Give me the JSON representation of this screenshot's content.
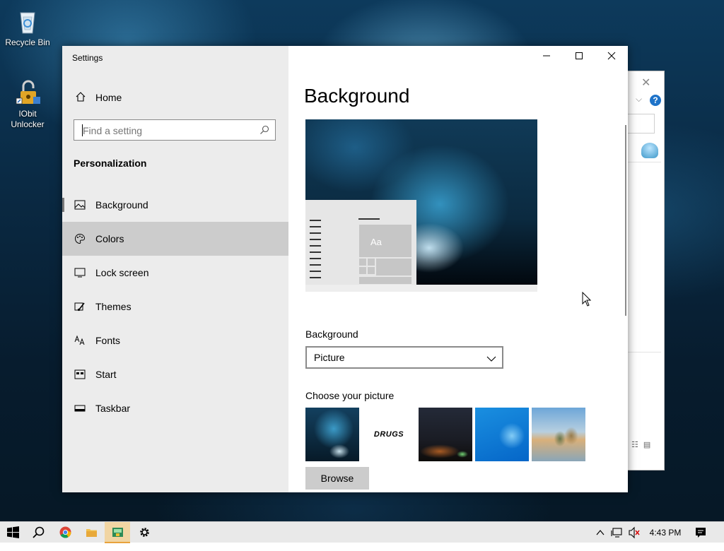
{
  "desktop": {
    "icons": [
      {
        "label": "Recycle Bin",
        "icon": "recycle-bin-icon"
      },
      {
        "label": "IObit Unlocker",
        "icon": "iobit-unlocker-icon"
      }
    ]
  },
  "window": {
    "title": "Settings",
    "controls": {
      "minimize": "minimize-icon",
      "maximize": "maximize-icon",
      "close": "close-icon"
    }
  },
  "sidebar": {
    "home_label": "Home",
    "search_placeholder": "Find a setting",
    "section_title": "Personalization",
    "items": [
      {
        "label": "Background",
        "icon": "picture-icon",
        "selected": true
      },
      {
        "label": "Colors",
        "icon": "palette-icon",
        "hovered": true
      },
      {
        "label": "Lock screen",
        "icon": "monitor-icon"
      },
      {
        "label": "Themes",
        "icon": "brush-icon"
      },
      {
        "label": "Fonts",
        "icon": "font-icon"
      },
      {
        "label": "Start",
        "icon": "start-icon"
      },
      {
        "label": "Taskbar",
        "icon": "taskbar-icon"
      }
    ]
  },
  "main": {
    "page_title": "Background",
    "preview_sample_text": "Aa",
    "background_label": "Background",
    "background_value": "Picture",
    "choose_picture_label": "Choose your picture",
    "thumbnails": [
      {
        "name": "ice-cave",
        "text": ""
      },
      {
        "name": "drugs-text",
        "text": "DRUGS"
      },
      {
        "name": "night-sky-tent",
        "text": ""
      },
      {
        "name": "windows-blue",
        "text": ""
      },
      {
        "name": "beach-rocks",
        "text": ""
      }
    ],
    "browse_label": "Browse"
  },
  "taskbar": {
    "apps": [
      "start-icon",
      "search-icon",
      "chrome-icon",
      "file-explorer-icon",
      "app-icon",
      "settings-gear-icon"
    ],
    "active_app": "app-icon",
    "time": "4:43 PM",
    "tray_icons": [
      "chevron-up-icon",
      "network-icon",
      "volume-muted-icon",
      "action-center-icon"
    ]
  },
  "colors": {
    "accent_orange": "#e8a23c",
    "sidebar_bg": "#ececec",
    "hover_bg": "#cccccc"
  }
}
